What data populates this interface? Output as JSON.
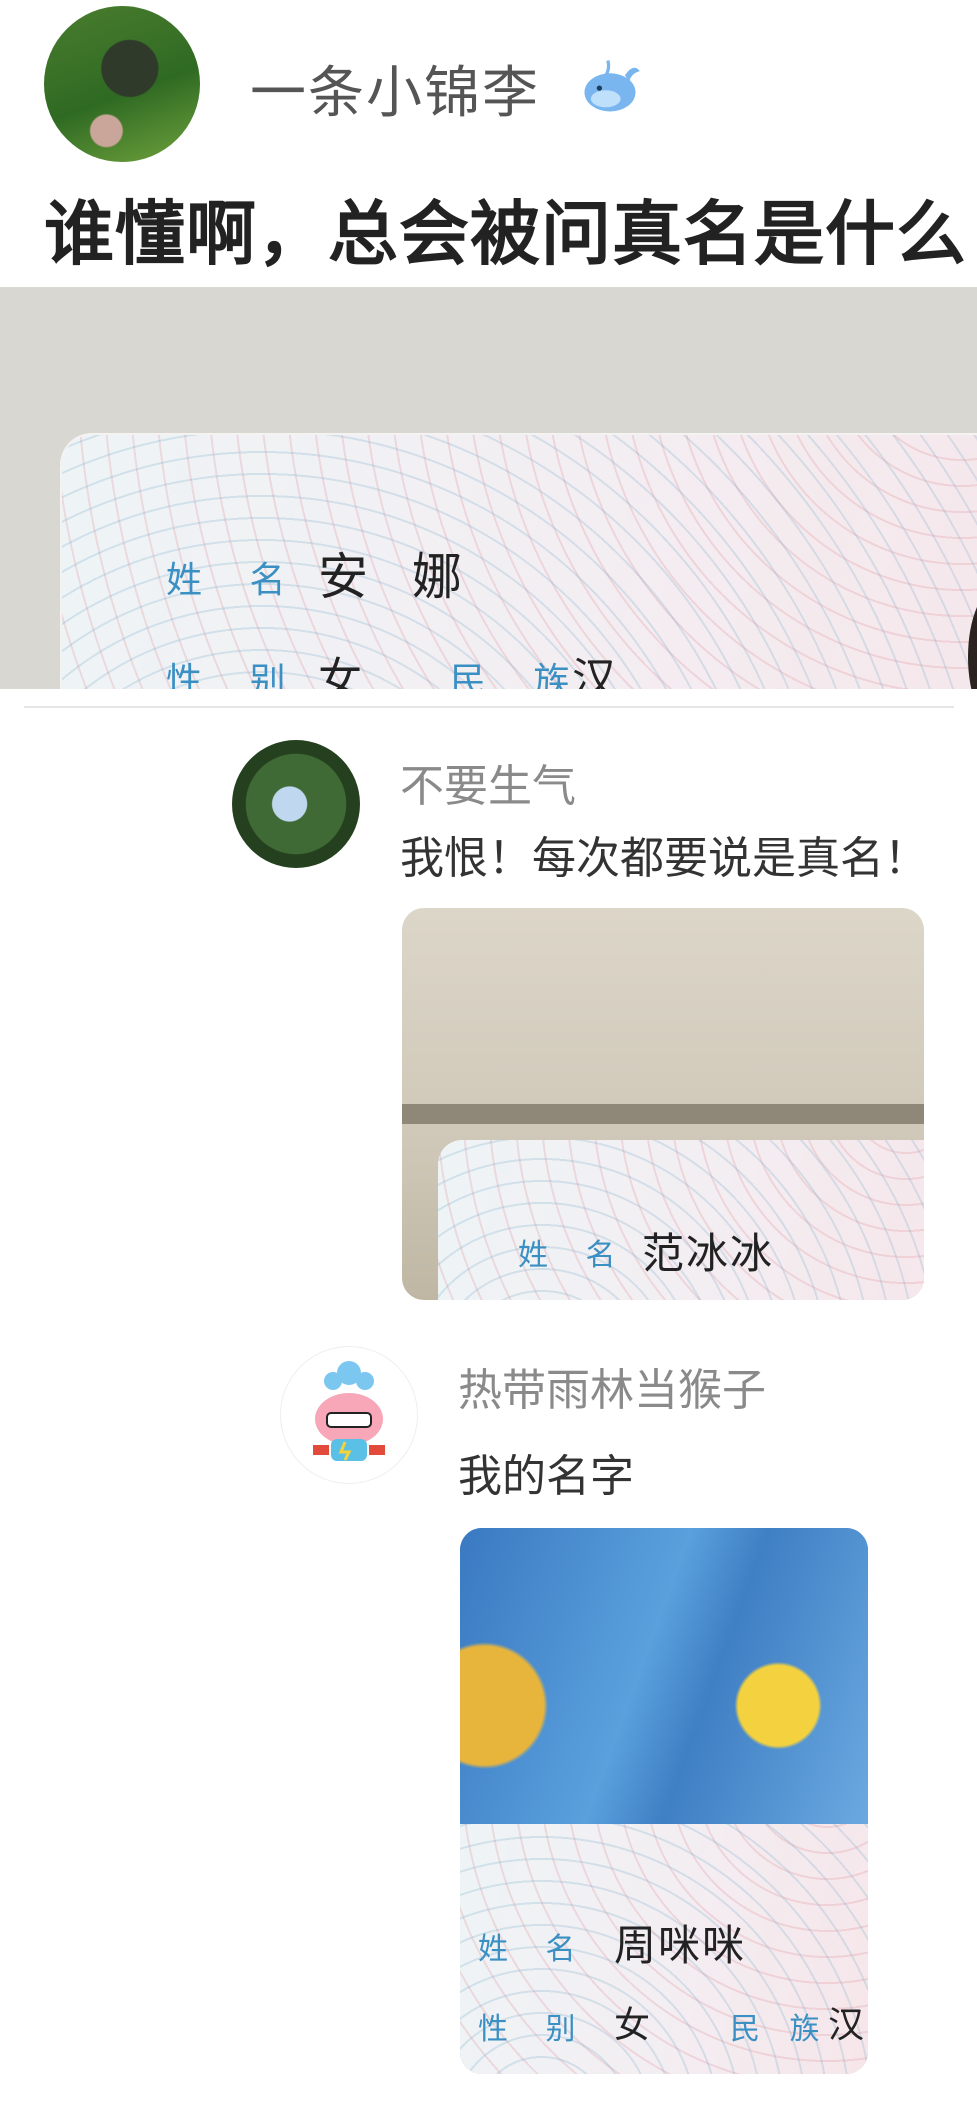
{
  "post": {
    "author": "一条小锦李",
    "title": "谁懂啊，总会被问真名是什么",
    "image": {
      "name_label": "姓 名",
      "name_value": "安 娜",
      "gender_label": "性 别",
      "gender_value": "女",
      "ethnicity_label": "民 族",
      "ethnicity_value": "汉"
    }
  },
  "comments": [
    {
      "username": "不要生气",
      "text": "我恨！每次都要说是真名！",
      "image": {
        "name_label": "姓 名",
        "name_value": "范冰冰"
      }
    },
    {
      "username": "热带雨林当猴子",
      "text": "我的名字",
      "image": {
        "name_label": "姓 名",
        "name_value": "周咪咪",
        "gender_label": "性 别",
        "gender_value": "女",
        "ethnicity_label": "民 族",
        "ethnicity_value": "汉"
      }
    }
  ],
  "colors": {
    "id_label": "#3a8fc3",
    "text_dark": "#222222",
    "text_gray": "#8a8a8a"
  }
}
